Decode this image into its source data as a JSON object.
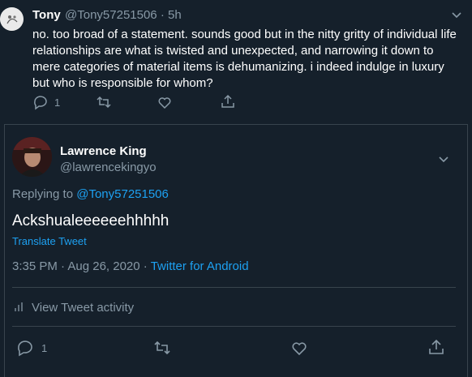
{
  "parent_tweet": {
    "display_name": "Tony",
    "handle": "@Tony57251506",
    "separator": "·",
    "time": "5h",
    "text": "no. too broad of a statement. sounds good but in the nitty gritty of individual life relationships are what is twisted and unexpected, and narrowing it down to mere categories of material items is dehumanizing.  i indeed indulge in luxury but who is responsible for whom?",
    "reply_count": "1"
  },
  "main_tweet": {
    "display_name": "Lawrence King",
    "handle": "@lawrencekingyo",
    "replying_prefix": "Replying to",
    "replying_handle": "@Tony57251506",
    "text": "Ackshualeeeeeehhhhh",
    "translate_label": "Translate Tweet",
    "date": "3:35 PM · Aug 26, 2020",
    "date_separator": " · ",
    "source": "Twitter for Android",
    "view_activity": "View Tweet activity",
    "reply_count": "1"
  },
  "icons": {
    "reply": "reply-icon",
    "retweet": "retweet-icon",
    "like": "like-icon",
    "share": "share-icon",
    "more": "chevron-down-icon",
    "activity": "activity-icon"
  },
  "colors": {
    "background": "#15202b",
    "text": "#ffffff",
    "muted": "#8899a6",
    "accent": "#1da1f2",
    "border": "#38444d"
  }
}
